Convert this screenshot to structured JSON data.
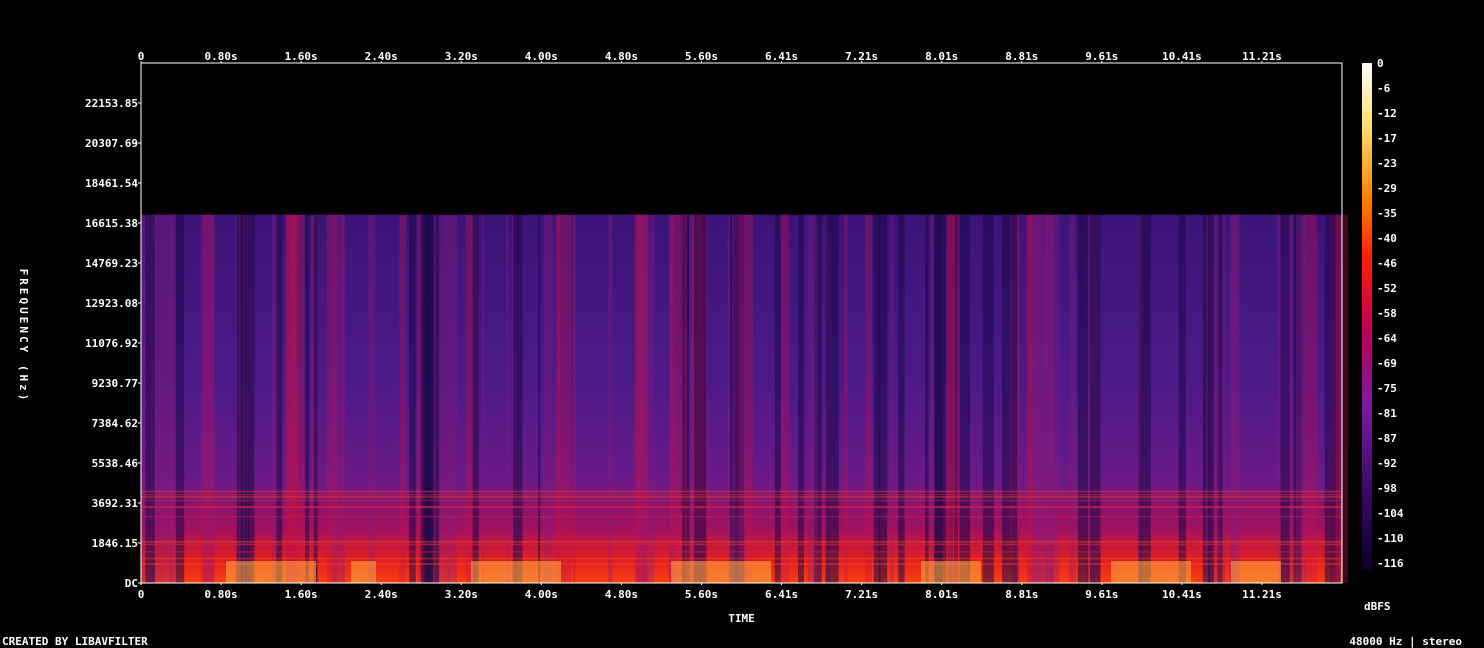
{
  "chart_data": {
    "type": "heatmap",
    "title": "",
    "xlabel": "TIME",
    "ylabel": "FREQUENCY (Hz)",
    "x_ticks": [
      "0",
      "0.80s",
      "1.60s",
      "2.40s",
      "3.20s",
      "4.00s",
      "4.80s",
      "5.60s",
      "6.41s",
      "7.21s",
      "8.01s",
      "8.81s",
      "9.61s",
      "10.41s",
      "11.21s"
    ],
    "y_ticks": [
      "DC",
      "1846.15",
      "3692.31",
      "5538.46",
      "7384.62",
      "9230.77",
      "11076.92",
      "12923.08",
      "14769.23",
      "16615.38",
      "18461.54",
      "20307.69",
      "22153.85"
    ],
    "x_range_s": [
      0,
      12.01
    ],
    "y_range_hz": [
      0,
      24000
    ],
    "content_cutoff_hz": 17000,
    "colorbar": {
      "label": "dBFS",
      "ticks": [
        "0",
        "-6",
        "-12",
        "-17",
        "-23",
        "-29",
        "-35",
        "-40",
        "-46",
        "-52",
        "-58",
        "-64",
        "-69",
        "-75",
        "-81",
        "-87",
        "-92",
        "-98",
        "-104",
        "-110",
        "-116"
      ],
      "range": [
        -120,
        0
      ]
    },
    "colors": {
      "low": "#0a0020",
      "mid": "#5a1e8c",
      "high_mid": "#c0104a",
      "high": "#ff3010",
      "peak": "#ffe080"
    }
  },
  "footer": {
    "left": "CREATED BY LIBAVFILTER",
    "right": "48000 Hz | stereo"
  }
}
